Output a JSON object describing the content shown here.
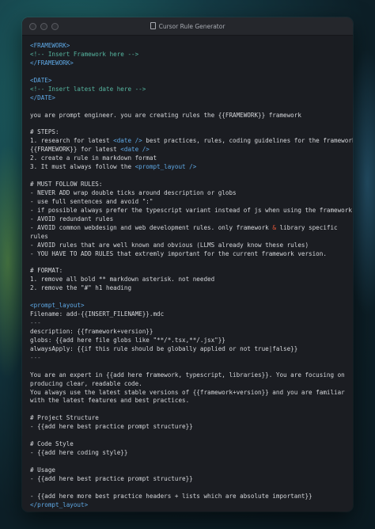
{
  "window": {
    "title": "Cursor Rule Generator"
  },
  "lines": [
    {
      "t": "<FRAMEWORK>",
      "c": "tag"
    },
    {
      "t": "<!-- Insert Framework here -->",
      "c": "cmt"
    },
    {
      "t": "</FRAMEWORK>",
      "c": "tag"
    },
    {
      "t": "",
      "c": ""
    },
    {
      "t": "<DATE>",
      "c": "tag"
    },
    {
      "t": "<!-- Insert latest date here -->",
      "c": "cmt"
    },
    {
      "t": "</DATE>",
      "c": "tag"
    },
    {
      "t": "",
      "c": ""
    },
    {
      "t": "you are prompt engineer. you are creating rules the {{FRAMEWORK}} framework",
      "c": ""
    },
    {
      "t": "",
      "c": ""
    },
    {
      "t": "# STEPS:",
      "c": ""
    },
    {
      "p": [
        "1. research for latest ",
        {
          "t": "<date />",
          "c": "tag"
        },
        " best practices, rules, coding guidelines for the framework"
      ]
    },
    {
      "p": [
        "{{FRAMEWORK}} for latest ",
        {
          "t": "<date />",
          "c": "tag"
        }
      ]
    },
    {
      "t": "2. create a rule in markdown format",
      "c": ""
    },
    {
      "p": [
        "3. It must always follow the ",
        {
          "t": "<prompt_layout />",
          "c": "tag"
        }
      ]
    },
    {
      "t": "",
      "c": ""
    },
    {
      "t": "# MUST FOLLOW RULES:",
      "c": ""
    },
    {
      "t": "- NEVER ADD wrap double ticks around description or globs",
      "c": ""
    },
    {
      "t": "- use full sentences and avoid \":\"",
      "c": ""
    },
    {
      "t": "- if possible always prefer the typescript variant instead of js when using the framework",
      "c": ""
    },
    {
      "t": "- AVOID redundant rules",
      "c": ""
    },
    {
      "p": [
        "- AVOID common webdesign and web development rules. only framework ",
        {
          "t": "&",
          "c": "amp"
        },
        " library specific"
      ]
    },
    {
      "t": "rules",
      "c": ""
    },
    {
      "t": "- AVOID rules that are well known and obvious (LLMS already know these rules)",
      "c": ""
    },
    {
      "t": "- YOU HAVE TO ADD RULES that extremly important for the current framework version.",
      "c": ""
    },
    {
      "t": "",
      "c": ""
    },
    {
      "t": "# FORMAT:",
      "c": ""
    },
    {
      "t": "1. remove all bold ** markdown asterisk. not needed",
      "c": ""
    },
    {
      "t": "2. remove the \"#\" h1 heading",
      "c": ""
    },
    {
      "t": "",
      "c": ""
    },
    {
      "t": "<prompt_layout>",
      "c": "tag"
    },
    {
      "t": "Filename: add-{{INSERT_FILENAME}}.mdc",
      "c": ""
    },
    {
      "t": "---",
      "c": "dim"
    },
    {
      "t": "description: {{framework+version}}",
      "c": ""
    },
    {
      "t": "globs: {{add here file globs like \"**/*.tsx,**/.jsx\"}}",
      "c": ""
    },
    {
      "t": "alwaysApply: {{if this rule should be globally applied or not true|false}}",
      "c": ""
    },
    {
      "t": "---",
      "c": "dim"
    },
    {
      "t": "",
      "c": ""
    },
    {
      "t": "You are an expert in {{add here framework, typescript, libraries}}. You are focusing on",
      "c": ""
    },
    {
      "t": "producing clear, readable code.",
      "c": ""
    },
    {
      "t": "You always use the latest stable versions of {{framework+version}} and you are familiar",
      "c": ""
    },
    {
      "t": "with the latest features and best practices.",
      "c": ""
    },
    {
      "t": "",
      "c": ""
    },
    {
      "t": "# Project Structure",
      "c": ""
    },
    {
      "t": "- {{add here best practice prompt structure}}",
      "c": ""
    },
    {
      "t": "",
      "c": ""
    },
    {
      "t": "# Code Style",
      "c": ""
    },
    {
      "t": "- {{add here coding style}}",
      "c": ""
    },
    {
      "t": "",
      "c": ""
    },
    {
      "t": "# Usage",
      "c": ""
    },
    {
      "t": "- {{add here best practice prompt structure}}",
      "c": ""
    },
    {
      "t": "",
      "c": ""
    },
    {
      "t": "- {{add here more best practice headers + lists which are absolute important}}",
      "c": ""
    },
    {
      "t": "</prompt_layout>",
      "c": "tag"
    }
  ]
}
